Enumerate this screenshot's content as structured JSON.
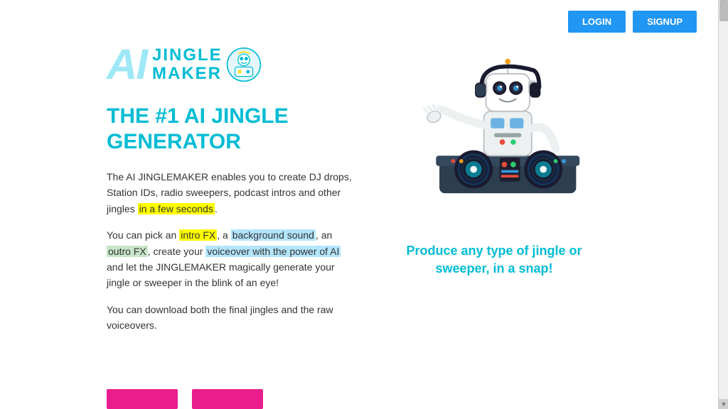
{
  "header": {
    "login_label": "LOGIN",
    "signup_label": "SIGNUP"
  },
  "logo": {
    "ai_text": "AI",
    "jingle_text": "JINGLE",
    "maker_text": "MAKER"
  },
  "heading": {
    "line1": "THE #1 AI JINGLE",
    "line2": "GENERATOR"
  },
  "description": {
    "para1": "The AI JINGLEMAKER enables you to create DJ drops, Station IDs, radio sweepers, podcast intros and other jingles ",
    "para1_highlight": "in a few seconds",
    "para1_end": ".",
    "para2_start": "You can pick an ",
    "para2_intro_fx": "intro FX",
    "para2_mid1": ", a ",
    "para2_bg": "background sound",
    "para2_mid2": ", an ",
    "para2_outro": "outro FX",
    "para2_mid3": ", create your ",
    "para2_vo": "voiceover with the power of AI",
    "para2_end": " and let the JINGLEMAKER magically generate your jingle or sweeper in the blink of an eye!",
    "para3": "You can download both the final jingles and the raw voiceovers."
  },
  "caption": {
    "line1": "Produce any type of jingle or",
    "line2": "sweeper, in a snap!"
  },
  "colors": {
    "primary": "#00bcd4",
    "button_blue": "#2196f3",
    "button_pink": "#e91e8c",
    "highlight_yellow": "#ffff00",
    "highlight_blue": "#b3e5fc",
    "highlight_lightblue": "#c8e6c9"
  }
}
